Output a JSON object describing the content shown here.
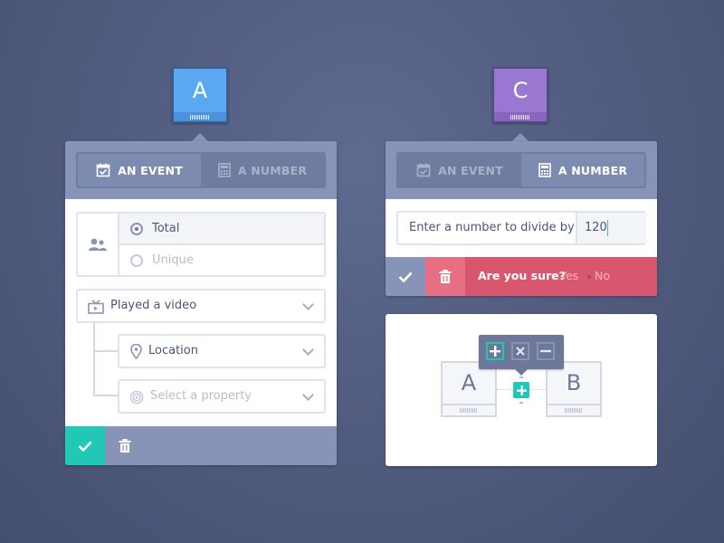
{
  "tile_a": {
    "letter": "A",
    "color": "#5aa7f2"
  },
  "tile_c": {
    "letter": "C",
    "color": "#9a78d2"
  },
  "left_panel": {
    "tabs": [
      {
        "label": "AN EVENT",
        "icon": "calendar-check-icon",
        "active": true
      },
      {
        "label": "A NUMBER",
        "icon": "calculator-icon",
        "active": false
      }
    ],
    "radio": {
      "icon": "users-icon",
      "options": [
        {
          "label": "Total",
          "selected": true
        },
        {
          "label": "Unique",
          "selected": false
        }
      ]
    },
    "event_select": {
      "label": "Played a video",
      "icon": "tv-icon"
    },
    "property_select": {
      "label": "Location",
      "icon": "map-pin-icon"
    },
    "property_placeholder": {
      "label": "Select a property",
      "icon": "target-icon"
    },
    "footer": {
      "confirm_icon": "check-icon",
      "delete_icon": "trash-icon",
      "confirm_color": "#1fc9b5"
    }
  },
  "right_panel": {
    "tabs": [
      {
        "label": "AN EVENT",
        "icon": "calendar-check-icon",
        "active": false
      },
      {
        "label": "A NUMBER",
        "icon": "calculator-icon",
        "active": true
      }
    ],
    "divide": {
      "label": "Enter a number to divide by",
      "value": "120"
    },
    "confirm_bar": {
      "question": "Are you sure?",
      "yes": "Yes",
      "no": "No",
      "color": "#d9576e"
    }
  },
  "diagram": {
    "node_a": "A",
    "node_b": "B",
    "operators": [
      {
        "icon": "plus-icon",
        "selected": true
      },
      {
        "icon": "multiply-icon",
        "selected": false
      },
      {
        "icon": "minus-icon",
        "selected": false
      }
    ],
    "accent": "#1fc9b5"
  }
}
